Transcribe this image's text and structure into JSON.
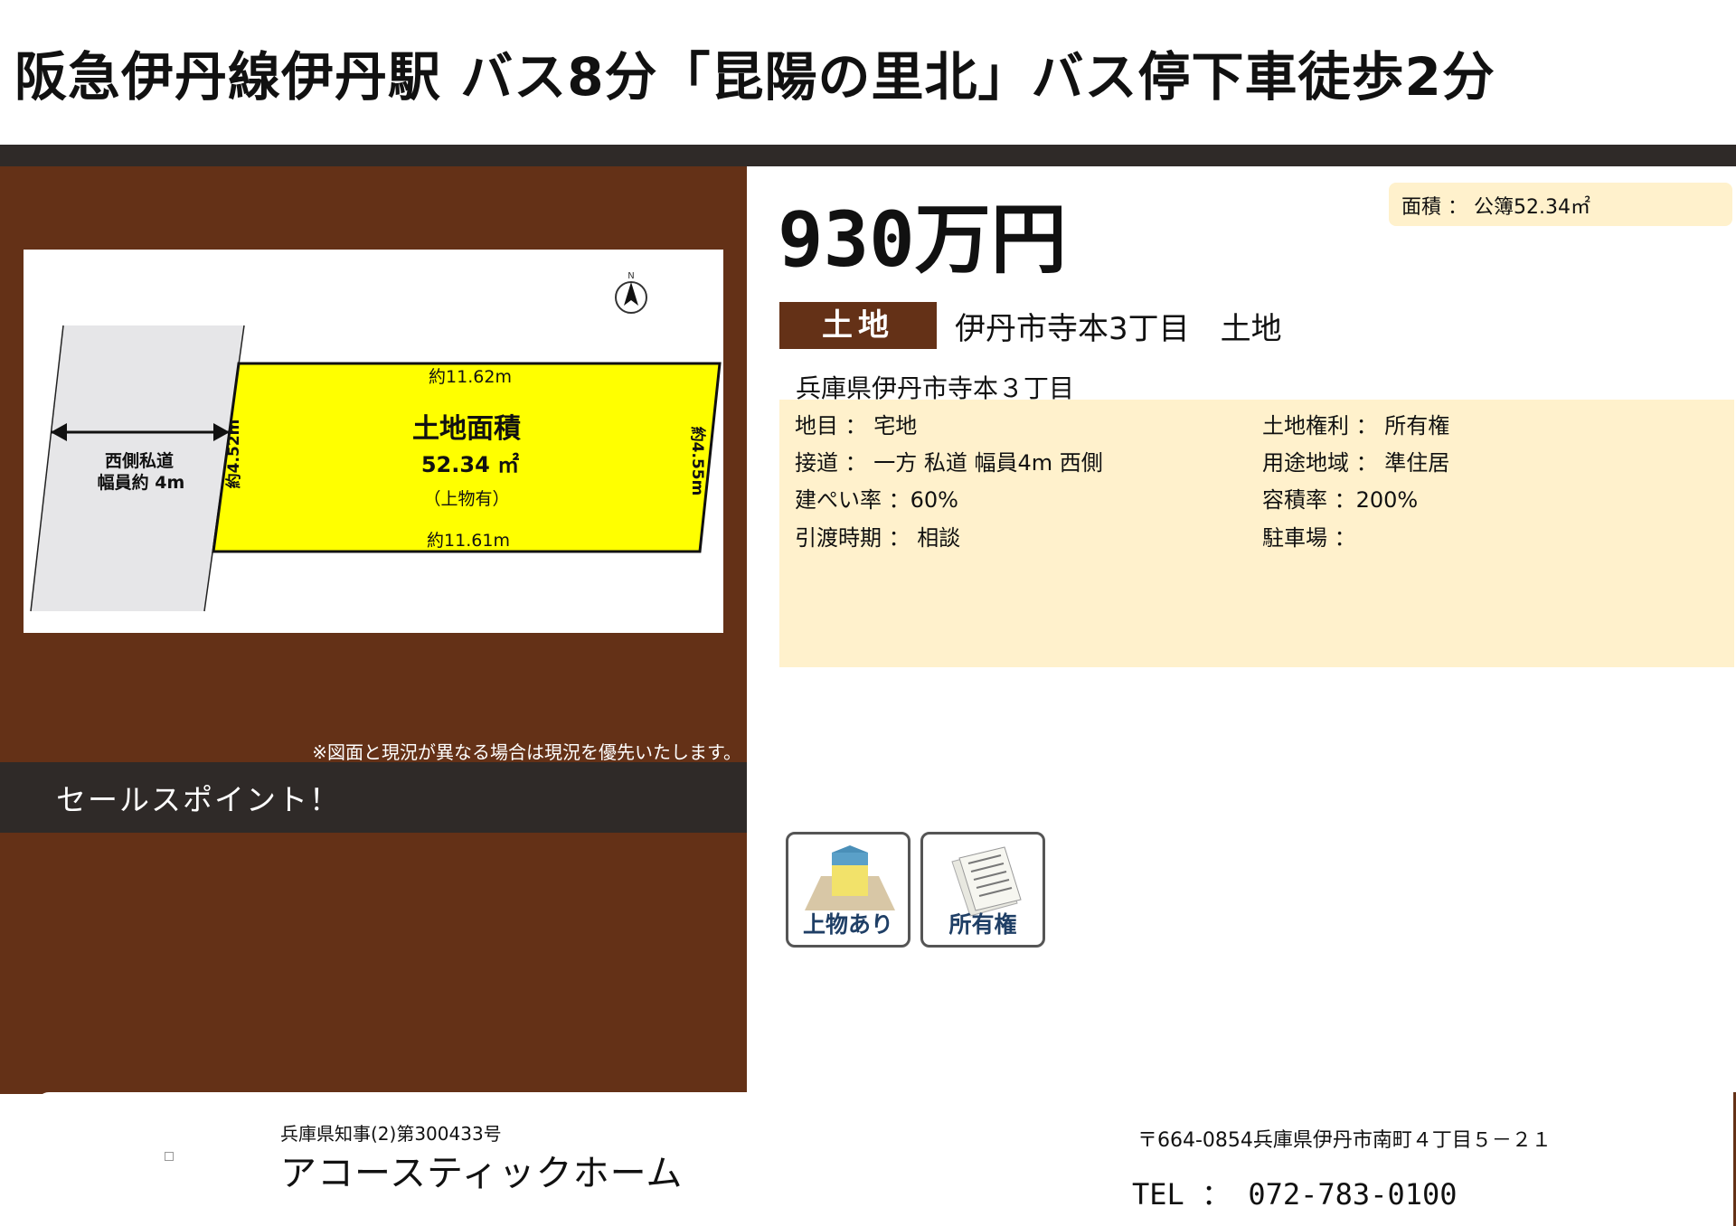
{
  "header": {
    "headline": "阪急伊丹線伊丹駅 バス8分「昆陽の里北」バス停下車徒歩2分"
  },
  "plan": {
    "labels": {
      "top_width": "約11.62m",
      "bottom_width": "約11.61m",
      "left_height": "約4.52m",
      "right_height": "約4.55m",
      "area_title": "土地面積",
      "area_value": "52.34 ㎡",
      "area_note": "（上物有）",
      "road_line1": "西側私道",
      "road_line2": "幅員約 4m",
      "north_mark": "N"
    },
    "note": "※図面と現況が異なる場合は現況を優先いたします。"
  },
  "sales": {
    "title": "セールスポイント！"
  },
  "price": "930万円",
  "area_badge": "面積 ： 公簿52.34㎡",
  "property_type": "土地",
  "listing_name": "伊丹市寺本3丁目　土地",
  "address": "兵庫県伊丹市寺本３丁目",
  "details": {
    "land_category": "地目 ： 宅地",
    "road_access": "接道 ： 一方 私道 幅員4m 西側",
    "coverage_ratio": "建ぺい率 ：60%",
    "handover": "引渡時期 ： 相談",
    "land_right": "土地権利 ： 所有権",
    "zoning": "用途地域 ： 準住居",
    "floor_area_ratio": "容積率 ：200%",
    "parking": "駐車場 ："
  },
  "tags": [
    {
      "label": "上物あり",
      "icon": "house-on-land-icon"
    },
    {
      "label": "所有権",
      "icon": "document-icon"
    }
  ],
  "footer": {
    "license": "兵庫県知事(2)第300433号",
    "company": "アコースティックホーム",
    "postal_address": "〒664-0854兵庫県伊丹市南町４丁目５－２１",
    "tel": "TEL ： 072-783-0100"
  },
  "colors": {
    "brown": "#643117",
    "dark": "#2f2a28",
    "cream": "#fff1cc",
    "plot_yellow": "#ffff00",
    "road_gray": "#e6e6e8"
  }
}
